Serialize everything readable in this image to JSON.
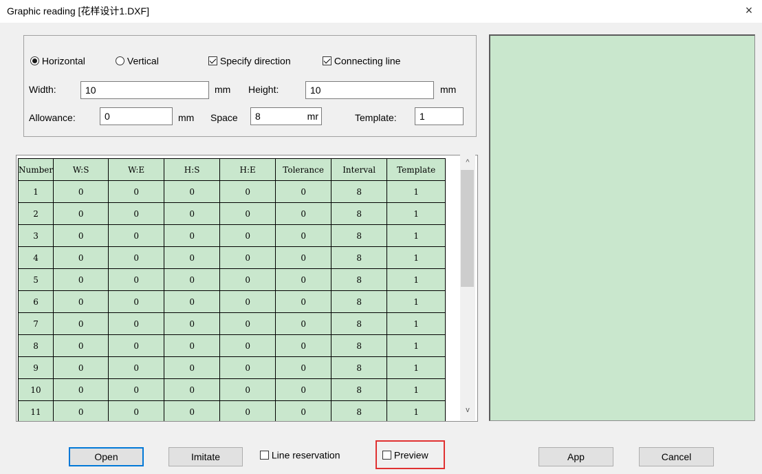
{
  "window": {
    "title": "Graphic reading [花样设计1.DXF]",
    "close_glyph": "×"
  },
  "options": {
    "horizontal": {
      "label": "Horizontal",
      "checked": true
    },
    "vertical": {
      "label": "Vertical",
      "checked": false
    },
    "specify_direction": {
      "label": "Specify direction",
      "checked": true
    },
    "connecting_line": {
      "label": "Connecting line",
      "checked": true
    },
    "width_label": "Width:",
    "width_value": "10",
    "width_unit": "mm",
    "height_label": "Height:",
    "height_value": "10",
    "height_unit": "mm",
    "allowance_label": "Allowance:",
    "allowance_value": "0",
    "allowance_unit": "mm",
    "space_label": "Space",
    "space_value": "8",
    "space_unit": "mr",
    "template_label": "Template:",
    "template_value": "1"
  },
  "table": {
    "headers": [
      "Number",
      "W:S",
      "W:E",
      "H:S",
      "H:E",
      "Tolerance",
      "Interval",
      "Template"
    ],
    "rows": [
      [
        "1",
        "0",
        "0",
        "0",
        "0",
        "0",
        "8",
        "1"
      ],
      [
        "2",
        "0",
        "0",
        "0",
        "0",
        "0",
        "8",
        "1"
      ],
      [
        "3",
        "0",
        "0",
        "0",
        "0",
        "0",
        "8",
        "1"
      ],
      [
        "4",
        "0",
        "0",
        "0",
        "0",
        "0",
        "8",
        "1"
      ],
      [
        "5",
        "0",
        "0",
        "0",
        "0",
        "0",
        "8",
        "1"
      ],
      [
        "6",
        "0",
        "0",
        "0",
        "0",
        "0",
        "8",
        "1"
      ],
      [
        "7",
        "0",
        "0",
        "0",
        "0",
        "0",
        "8",
        "1"
      ],
      [
        "8",
        "0",
        "0",
        "0",
        "0",
        "0",
        "8",
        "1"
      ],
      [
        "9",
        "0",
        "0",
        "0",
        "0",
        "0",
        "8",
        "1"
      ],
      [
        "10",
        "0",
        "0",
        "0",
        "0",
        "0",
        "8",
        "1"
      ],
      [
        "11",
        "0",
        "0",
        "0",
        "0",
        "0",
        "8",
        "1"
      ]
    ]
  },
  "scrollbar": {
    "up_glyph": "^",
    "down_glyph": "v"
  },
  "buttons": {
    "open": "Open",
    "imitate": "Imitate",
    "line_reservation": {
      "label": "Line reservation",
      "checked": false
    },
    "preview": {
      "label": "Preview",
      "checked": false
    },
    "app": "App",
    "cancel": "Cancel"
  },
  "colors": {
    "grid_fill": "#c9e7cd",
    "highlight": "#e03030",
    "default_button_border": "#0078d7"
  }
}
